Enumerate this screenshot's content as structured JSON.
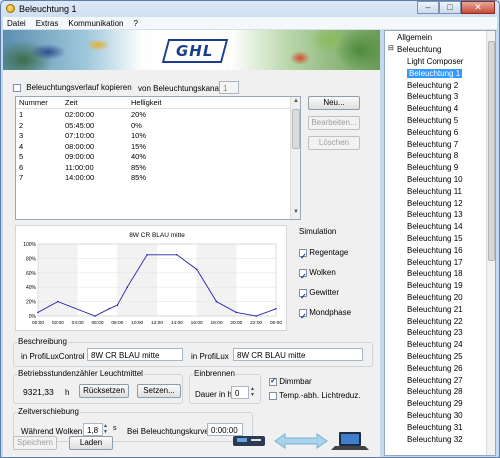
{
  "window": {
    "title": "Beleuchtung 1",
    "btn_min": "–",
    "btn_max": "□",
    "btn_close": "✕"
  },
  "menu": [
    "Datei",
    "Extras",
    "Kommunikation",
    "?"
  ],
  "banner": {
    "logo": "GHL"
  },
  "copy": {
    "label": "Beleuchtungsverlauf kopieren",
    "channel_label": "von Beleuchtungskanal",
    "channel_value": "1"
  },
  "table": {
    "headers": [
      "Nummer",
      "Zeit",
      "Helligkeit"
    ],
    "rows": [
      [
        "1",
        "02:00:00",
        "20%"
      ],
      [
        "2",
        "05:45:00",
        "0%"
      ],
      [
        "3",
        "07:10:00",
        "10%"
      ],
      [
        "4",
        "08:00:00",
        "15%"
      ],
      [
        "5",
        "09:00:00",
        "40%"
      ],
      [
        "6",
        "11:00:00",
        "85%"
      ],
      [
        "7",
        "14:00:00",
        "85%"
      ]
    ]
  },
  "buttons": {
    "new": "Neu...",
    "edit": "Bearbeiten...",
    "delete": "Löschen",
    "reset": "Rücksetzen",
    "set": "Setzen...",
    "save": "Speichern",
    "load": "Laden"
  },
  "chart_data": {
    "type": "line",
    "title": "8W CR BLAU mitte",
    "x": [
      "00:00",
      "02:00",
      "04:00",
      "06:00",
      "08:00",
      "10:00",
      "12:00",
      "14:00",
      "16:00",
      "18:00",
      "20:00",
      "22:00",
      "00:00"
    ],
    "yticks": [
      "100%",
      "80%",
      "60%",
      "40%",
      "20%",
      "0%"
    ],
    "points": [
      [
        0,
        5
      ],
      [
        2,
        20
      ],
      [
        5.75,
        0
      ],
      [
        7.17,
        10
      ],
      [
        8,
        15
      ],
      [
        9,
        40
      ],
      [
        11,
        85
      ],
      [
        14,
        85
      ],
      [
        16,
        65
      ],
      [
        18,
        20
      ],
      [
        20,
        5
      ],
      [
        22,
        0
      ],
      [
        24,
        10
      ]
    ],
    "ylim": [
      0,
      100
    ],
    "color": "#2222aa"
  },
  "simulation": {
    "title": "Simulation",
    "items": [
      {
        "label": "Regentage",
        "checked": true
      },
      {
        "label": "Wolken",
        "checked": true
      },
      {
        "label": "Gewitter",
        "checked": true
      },
      {
        "label": "Mondphase",
        "checked": true
      }
    ]
  },
  "beschreibung": {
    "title": "Beschreibung",
    "control_label": "in ProfiLuxControl",
    "control_value": "8W CR BLAU mitte",
    "lux_label": "in ProfiLux",
    "lux_value": "8W CR BLAU mitte"
  },
  "counter": {
    "title": "Betriebsstundenzähler Leuchtmittel",
    "value": "9321,33",
    "unit": "h"
  },
  "einbrennen": {
    "title": "Einbrennen",
    "label": "Dauer in h",
    "value": "0"
  },
  "dimmbar": {
    "label": "Dimmbar",
    "checked": true
  },
  "temp": {
    "label": "Temp.-abh. Lichtreduz.",
    "checked": false
  },
  "zeit": {
    "title": "Zeitverschiebung",
    "wolken_label": "Während Wolken",
    "wolken_value": "1,8",
    "wolken_unit": "s",
    "kurve_label": "Bei Beleuchtungskurve",
    "kurve_value": "0:00:00"
  },
  "tree": {
    "root": "Allgemein",
    "group": "Beleuchtung",
    "items": [
      "Light Composer",
      "Beleuchtung 1",
      "Beleuchtung 2",
      "Beleuchtung 3",
      "Beleuchtung 4",
      "Beleuchtung 5",
      "Beleuchtung 6",
      "Beleuchtung 7",
      "Beleuchtung 8",
      "Beleuchtung 9",
      "Beleuchtung 10",
      "Beleuchtung 11",
      "Beleuchtung 12",
      "Beleuchtung 13",
      "Beleuchtung 14",
      "Beleuchtung 15",
      "Beleuchtung 16",
      "Beleuchtung 17",
      "Beleuchtung 18",
      "Beleuchtung 19",
      "Beleuchtung 20",
      "Beleuchtung 21",
      "Beleuchtung 22",
      "Beleuchtung 23",
      "Beleuchtung 24",
      "Beleuchtung 25",
      "Beleuchtung 26",
      "Beleuchtung 27",
      "Beleuchtung 28",
      "Beleuchtung 29",
      "Beleuchtung 30",
      "Beleuchtung 31",
      "Beleuchtung 32"
    ],
    "selected": "Beleuchtung 1"
  }
}
